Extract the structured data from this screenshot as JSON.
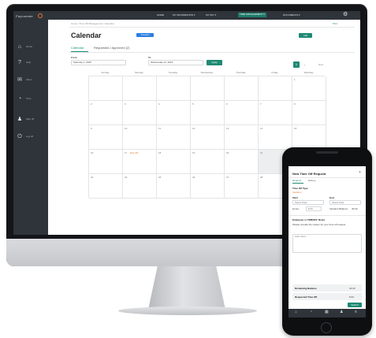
{
  "app": {
    "logo": "Paycomate",
    "colors": {
      "primary": "#1f8a74",
      "nav": "#2f343a",
      "accent": "#e8762d",
      "info": "#2d7fe0"
    }
  },
  "sidebar": {
    "items": [
      {
        "icon": "home-icon",
        "glyph": "⌂",
        "label": "Home"
      },
      {
        "icon": "help-icon",
        "glyph": "?",
        "label": "Help"
      },
      {
        "icon": "mail-icon",
        "glyph": "✉",
        "label": "Inbox"
      },
      {
        "icon": "clock-icon",
        "glyph": "◔",
        "label": "Time"
      },
      {
        "icon": "user-icon",
        "glyph": "♟",
        "label": "Sign off"
      },
      {
        "icon": "logout-icon",
        "glyph": "⏻",
        "label": "Log off"
      }
    ]
  },
  "topnav": {
    "items": [
      {
        "label": "HOME"
      },
      {
        "label": "MY INFORMATION ▾"
      },
      {
        "label": "MY PAY ▾"
      },
      {
        "label": "TIME MANAGEMENT ▾"
      },
      {
        "label": "DOCUMENTS ▾"
      }
    ],
    "active_index": 3
  },
  "main": {
    "breadcrumb": "Home / Time Off Management / Calendar",
    "print_link": "Print",
    "title": "Calendar",
    "badge": "Timeline",
    "add_button": "Add",
    "tabs": [
      {
        "label": "Calendar"
      },
      {
        "label": "Requested / Approved (2)"
      }
    ],
    "filters": {
      "from_label": "From",
      "from_value": "Saturday 1, 2016",
      "to_label": "To",
      "to_value": "Wednesday 31, 2016",
      "apply_button": "Apply"
    },
    "pager": {
      "current": "1",
      "next": "›",
      "label": "Next"
    },
    "weekdays": [
      "Sunday",
      "Monday",
      "Tuesday",
      "Wednesday",
      "Thursday",
      "Friday",
      "Saturday"
    ],
    "weeks": [
      [
        "",
        "",
        "",
        "",
        "",
        "",
        "1"
      ],
      [
        "2",
        "3",
        "4",
        "5",
        "6",
        "7",
        "8"
      ],
      [
        "9",
        "10",
        "11",
        "12",
        "13",
        "14",
        "15"
      ],
      [
        "16",
        "17",
        "18",
        "19",
        "20",
        "21",
        "22"
      ],
      [
        "23",
        "24",
        "25",
        "26",
        "27",
        "28",
        "29"
      ]
    ],
    "event": {
      "label": "Day Off"
    }
  },
  "phone": {
    "title": "New Time Off Request",
    "tabs": [
      {
        "label": "Request"
      },
      {
        "label": "History"
      }
    ],
    "section_label": "Time Off Type",
    "type_value": "Vacation",
    "start_label": "Start",
    "start_value": "Select Date",
    "end_label": "End",
    "end_value": "Select Date",
    "hours_label": "Hours",
    "hours_value": "8.00",
    "balance_label": "Vacation Balance",
    "balance_value": "40.00",
    "notes_heading": "Employee or TIMEOFF Notes",
    "notes_text": "Please provide the reason for your time off request",
    "notes_placeholder": "Add notes...",
    "remaining_label": "Remaining Balance",
    "remaining_value": "32.00",
    "requested_label": "Requested Time Off",
    "requested_value": "8.00",
    "submit_button": "Submit",
    "tabbar": [
      {
        "icon": "home-icon",
        "glyph": "⌂"
      },
      {
        "icon": "clock-icon",
        "glyph": "◔"
      },
      {
        "icon": "calendar-icon",
        "glyph": "▦"
      },
      {
        "icon": "user-icon",
        "glyph": "♟"
      },
      {
        "icon": "menu-icon",
        "glyph": "≡"
      }
    ]
  }
}
